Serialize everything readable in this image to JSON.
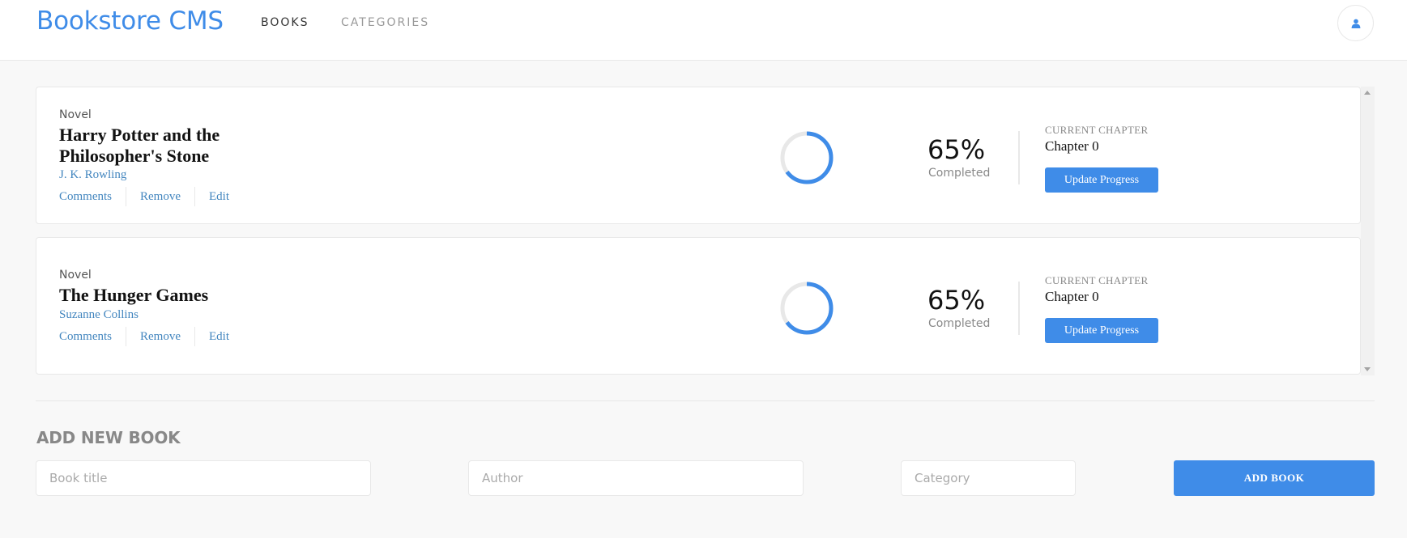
{
  "app": {
    "logo": "Bookstore CMS",
    "nav": [
      "BOOKS",
      "CATEGORIES"
    ],
    "user_icon": "user-icon"
  },
  "books": [
    {
      "category": "Novel",
      "title": "Harry Potter and the Philosopher's Stone",
      "author": "J. K. Rowling",
      "actions": [
        "Comments",
        "Remove",
        "Edit"
      ],
      "progress": 0.65,
      "percent_label": "65%",
      "completed_label": "Completed",
      "chapter_label": "CURRENT CHAPTER",
      "chapter": "Chapter 0",
      "update_label": "Update Progress"
    },
    {
      "category": "Novel",
      "title": "The Hunger Games",
      "author": "Suzanne Collins",
      "actions": [
        "Comments",
        "Remove",
        "Edit"
      ],
      "progress": 0.65,
      "percent_label": "65%",
      "completed_label": "Completed",
      "chapter_label": "CURRENT CHAPTER",
      "chapter": "Chapter 0",
      "update_label": "Update Progress"
    }
  ],
  "form": {
    "heading": "ADD NEW BOOK",
    "title_placeholder": "Book title",
    "author_placeholder": "Author",
    "category_placeholder": "Category",
    "submit_label": "ADD BOOK"
  },
  "colors": {
    "accent": "#3f8ce8",
    "progress_track": "#e8e8e8"
  }
}
